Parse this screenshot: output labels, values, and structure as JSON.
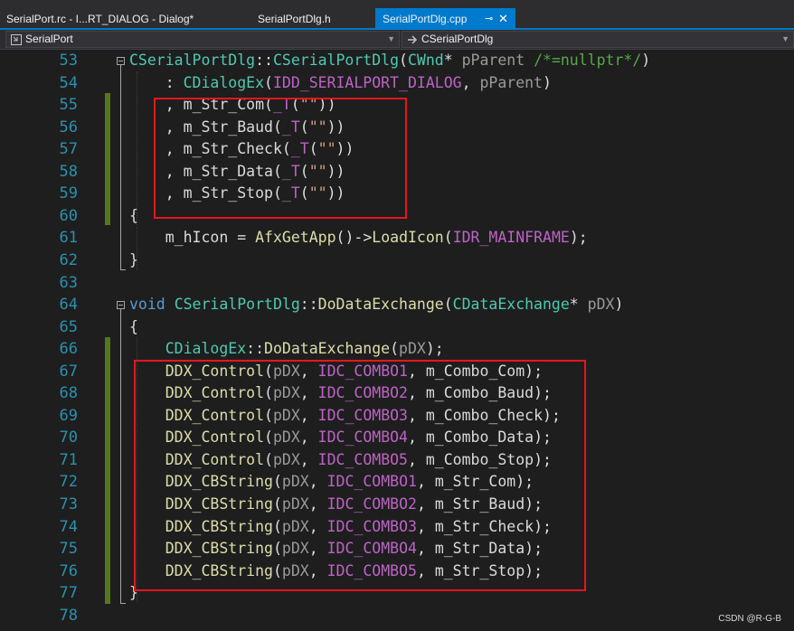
{
  "tabs": [
    {
      "label": "SerialPort.rc - I...RT_DIALOG - Dialog*"
    },
    {
      "label": "SerialPortDlg.h"
    },
    {
      "label": "SerialPortDlg.cpp",
      "pin": "⊸",
      "close": "✕"
    }
  ],
  "nav": {
    "project": "SerialPort",
    "scope": "CSerialPortDlg"
  },
  "lines": [
    {
      "n": "53",
      "segs": [
        [
          "cls",
          "CSerialPortDlg"
        ],
        [
          "",
          "::"
        ],
        [
          "cls",
          "CSerialPortDlg"
        ],
        [
          "",
          "("
        ],
        [
          "cls",
          "CWnd"
        ],
        [
          "",
          "* "
        ],
        [
          "par",
          "pParent"
        ],
        [
          "cm",
          " /*=nullptr*/"
        ],
        [
          "",
          ")"
        ]
      ]
    },
    {
      "n": "54",
      "segs": [
        [
          "",
          "    : "
        ],
        [
          "cls",
          "CDialogEx"
        ],
        [
          "",
          "("
        ],
        [
          "mac",
          "IDD_SERIALPORT_DIALOG"
        ],
        [
          "",
          ", "
        ],
        [
          "par",
          "pParent"
        ],
        [
          "",
          ")"
        ]
      ]
    },
    {
      "n": "55",
      "segs": [
        [
          "",
          "    , "
        ],
        [
          "var",
          "m_Str_Com"
        ],
        [
          "",
          "("
        ],
        [
          "mac",
          "_T"
        ],
        [
          "",
          "("
        ],
        [
          "str",
          "\"\""
        ],
        [
          "",
          "))"
        ]
      ]
    },
    {
      "n": "56",
      "segs": [
        [
          "",
          "    , "
        ],
        [
          "var",
          "m_Str_Baud"
        ],
        [
          "",
          "("
        ],
        [
          "mac",
          "_T"
        ],
        [
          "",
          "("
        ],
        [
          "str",
          "\"\""
        ],
        [
          "",
          "))"
        ]
      ]
    },
    {
      "n": "57",
      "segs": [
        [
          "",
          "    , "
        ],
        [
          "var",
          "m_Str_Check"
        ],
        [
          "",
          "("
        ],
        [
          "mac",
          "_T"
        ],
        [
          "",
          "("
        ],
        [
          "str",
          "\"\""
        ],
        [
          "",
          "))"
        ]
      ]
    },
    {
      "n": "58",
      "segs": [
        [
          "",
          "    , "
        ],
        [
          "var",
          "m_Str_Data"
        ],
        [
          "",
          "("
        ],
        [
          "mac",
          "_T"
        ],
        [
          "",
          "("
        ],
        [
          "str",
          "\"\""
        ],
        [
          "",
          "))"
        ]
      ]
    },
    {
      "n": "59",
      "segs": [
        [
          "",
          "    , "
        ],
        [
          "var",
          "m_Str_Stop"
        ],
        [
          "",
          "("
        ],
        [
          "mac",
          "_T"
        ],
        [
          "",
          "("
        ],
        [
          "str",
          "\"\""
        ],
        [
          "",
          "))"
        ]
      ]
    },
    {
      "n": "60",
      "segs": [
        [
          "",
          "{"
        ]
      ]
    },
    {
      "n": "61",
      "segs": [
        [
          "",
          "    "
        ],
        [
          "var",
          "m_hIcon"
        ],
        [
          "",
          " = "
        ],
        [
          "fn",
          "AfxGetApp"
        ],
        [
          "",
          "()->"
        ],
        [
          "fn",
          "LoadIcon"
        ],
        [
          "",
          "("
        ],
        [
          "mac",
          "IDR_MAINFRAME"
        ],
        [
          "",
          ");"
        ]
      ]
    },
    {
      "n": "62",
      "segs": [
        [
          "",
          "}"
        ]
      ]
    },
    {
      "n": "63",
      "segs": []
    },
    {
      "n": "64",
      "segs": [
        [
          "kw",
          "void"
        ],
        [
          "",
          " "
        ],
        [
          "cls",
          "CSerialPortDlg"
        ],
        [
          "",
          "::"
        ],
        [
          "fn",
          "DoDataExchange"
        ],
        [
          "",
          "("
        ],
        [
          "cls",
          "CDataExchange"
        ],
        [
          "",
          "* "
        ],
        [
          "par",
          "pDX"
        ],
        [
          "",
          ")"
        ]
      ]
    },
    {
      "n": "65",
      "segs": [
        [
          "",
          "{"
        ]
      ]
    },
    {
      "n": "66",
      "segs": [
        [
          "",
          "    "
        ],
        [
          "cls",
          "CDialogEx"
        ],
        [
          "",
          "::"
        ],
        [
          "fn",
          "DoDataExchange"
        ],
        [
          "",
          "("
        ],
        [
          "par",
          "pDX"
        ],
        [
          "",
          ");"
        ]
      ]
    },
    {
      "n": "67",
      "segs": [
        [
          "",
          "    "
        ],
        [
          "fn",
          "DDX_Control"
        ],
        [
          "",
          "("
        ],
        [
          "par",
          "pDX"
        ],
        [
          "",
          ", "
        ],
        [
          "mac",
          "IDC_COMBO1"
        ],
        [
          "",
          ", "
        ],
        [
          "var",
          "m_Combo_Com"
        ],
        [
          "",
          ");"
        ]
      ]
    },
    {
      "n": "68",
      "segs": [
        [
          "",
          "    "
        ],
        [
          "fn",
          "DDX_Control"
        ],
        [
          "",
          "("
        ],
        [
          "par",
          "pDX"
        ],
        [
          "",
          ", "
        ],
        [
          "mac",
          "IDC_COMBO2"
        ],
        [
          "",
          ", "
        ],
        [
          "var",
          "m_Combo_Baud"
        ],
        [
          "",
          ");"
        ]
      ]
    },
    {
      "n": "69",
      "segs": [
        [
          "",
          "    "
        ],
        [
          "fn",
          "DDX_Control"
        ],
        [
          "",
          "("
        ],
        [
          "par",
          "pDX"
        ],
        [
          "",
          ", "
        ],
        [
          "mac",
          "IDC_COMBO3"
        ],
        [
          "",
          ", "
        ],
        [
          "var",
          "m_Combo_Check"
        ],
        [
          "",
          ");"
        ]
      ]
    },
    {
      "n": "70",
      "segs": [
        [
          "",
          "    "
        ],
        [
          "fn",
          "DDX_Control"
        ],
        [
          "",
          "("
        ],
        [
          "par",
          "pDX"
        ],
        [
          "",
          ", "
        ],
        [
          "mac",
          "IDC_COMBO4"
        ],
        [
          "",
          ", "
        ],
        [
          "var",
          "m_Combo_Data"
        ],
        [
          "",
          ");"
        ]
      ]
    },
    {
      "n": "71",
      "segs": [
        [
          "",
          "    "
        ],
        [
          "fn",
          "DDX_Control"
        ],
        [
          "",
          "("
        ],
        [
          "par",
          "pDX"
        ],
        [
          "",
          ", "
        ],
        [
          "mac",
          "IDC_COMBO5"
        ],
        [
          "",
          ", "
        ],
        [
          "var",
          "m_Combo_Stop"
        ],
        [
          "",
          ");"
        ]
      ]
    },
    {
      "n": "72",
      "segs": [
        [
          "",
          "    "
        ],
        [
          "fn",
          "DDX_CBString"
        ],
        [
          "",
          "("
        ],
        [
          "par",
          "pDX"
        ],
        [
          "",
          ", "
        ],
        [
          "mac",
          "IDC_COMBO1"
        ],
        [
          "",
          ", "
        ],
        [
          "var",
          "m_Str_Com"
        ],
        [
          "",
          ");"
        ]
      ]
    },
    {
      "n": "73",
      "segs": [
        [
          "",
          "    "
        ],
        [
          "fn",
          "DDX_CBString"
        ],
        [
          "",
          "("
        ],
        [
          "par",
          "pDX"
        ],
        [
          "",
          ", "
        ],
        [
          "mac",
          "IDC_COMBO2"
        ],
        [
          "",
          ", "
        ],
        [
          "var",
          "m_Str_Baud"
        ],
        [
          "",
          ");"
        ]
      ]
    },
    {
      "n": "74",
      "segs": [
        [
          "",
          "    "
        ],
        [
          "fn",
          "DDX_CBString"
        ],
        [
          "",
          "("
        ],
        [
          "par",
          "pDX"
        ],
        [
          "",
          ", "
        ],
        [
          "mac",
          "IDC_COMBO3"
        ],
        [
          "",
          ", "
        ],
        [
          "var",
          "m_Str_Check"
        ],
        [
          "",
          ");"
        ]
      ]
    },
    {
      "n": "75",
      "segs": [
        [
          "",
          "    "
        ],
        [
          "fn",
          "DDX_CBString"
        ],
        [
          "",
          "("
        ],
        [
          "par",
          "pDX"
        ],
        [
          "",
          ", "
        ],
        [
          "mac",
          "IDC_COMBO4"
        ],
        [
          "",
          ", "
        ],
        [
          "var",
          "m_Str_Data"
        ],
        [
          "",
          ");"
        ]
      ]
    },
    {
      "n": "76",
      "segs": [
        [
          "",
          "    "
        ],
        [
          "fn",
          "DDX_CBString"
        ],
        [
          "",
          "("
        ],
        [
          "par",
          "pDX"
        ],
        [
          "",
          ", "
        ],
        [
          "mac",
          "IDC_COMBO5"
        ],
        [
          "",
          ", "
        ],
        [
          "var",
          "m_Str_Stop"
        ],
        [
          "",
          ");"
        ]
      ]
    },
    {
      "n": "77",
      "segs": [
        [
          "",
          "}"
        ]
      ]
    },
    {
      "n": "78",
      "segs": []
    }
  ],
  "watermark": "CSDN @R-G-B",
  "colors": {
    "accent": "#007acc",
    "highlight_box": "#e8161c",
    "change_bar": "#55771f"
  }
}
